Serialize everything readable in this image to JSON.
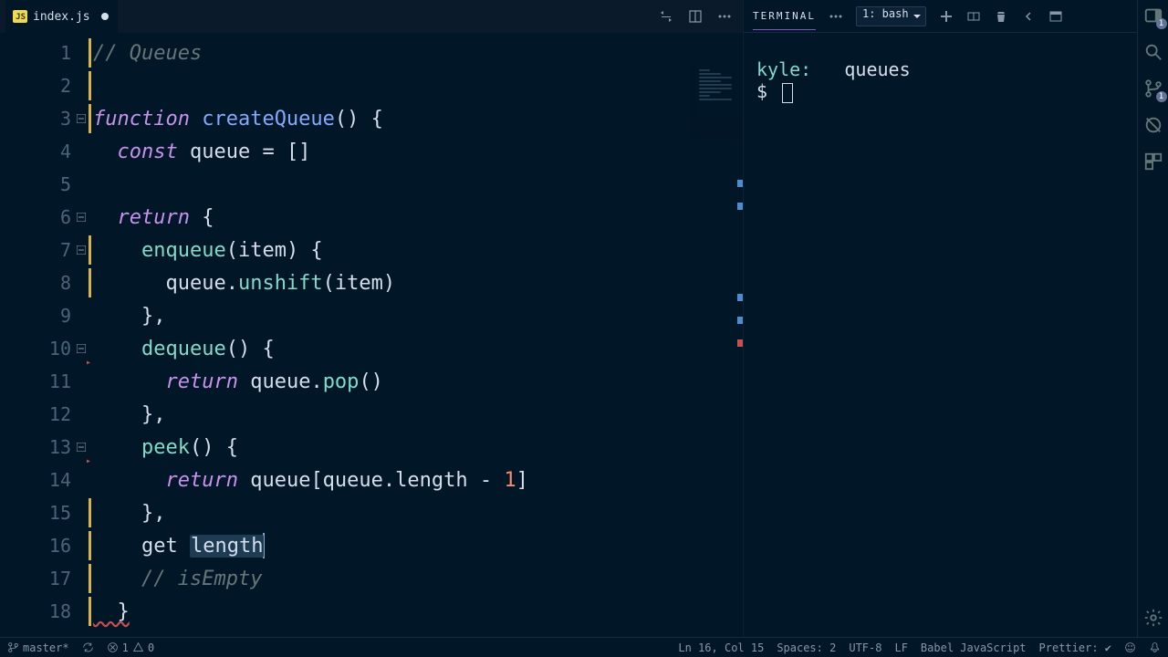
{
  "tab": {
    "filename": "index.js",
    "icon": "JS",
    "dirty": true
  },
  "editor_actions": {
    "compare": "compare-icon",
    "split": "split-icon",
    "more": "more-icon"
  },
  "code_lines": [
    {
      "n": 1,
      "mod": true,
      "tokens": [
        [
          "// Queues",
          "comment"
        ]
      ]
    },
    {
      "n": 2,
      "mod": true,
      "tokens": []
    },
    {
      "n": 3,
      "mod": true,
      "fold": true,
      "tokens": [
        [
          "function",
          "keyword"
        ],
        [
          " ",
          "punct"
        ],
        [
          "createQueue",
          "fn"
        ],
        [
          "() {",
          "punct"
        ]
      ]
    },
    {
      "n": 4,
      "mod": false,
      "tokens": [
        [
          "  ",
          "punct"
        ],
        [
          "const",
          "keyword"
        ],
        [
          " queue = []",
          "var"
        ]
      ]
    },
    {
      "n": 5,
      "mod": false,
      "tokens": []
    },
    {
      "n": 6,
      "mod": false,
      "fold": true,
      "tokens": [
        [
          "  ",
          "punct"
        ],
        [
          "return",
          "keyword"
        ],
        [
          " {",
          "punct"
        ]
      ]
    },
    {
      "n": 7,
      "mod": true,
      "fold": true,
      "tokens": [
        [
          "    ",
          "punct"
        ],
        [
          "enqueue",
          "prop"
        ],
        [
          "(",
          "punct"
        ],
        [
          "item",
          "ident"
        ],
        [
          ") {",
          "punct"
        ]
      ]
    },
    {
      "n": 8,
      "mod": true,
      "tokens": [
        [
          "      queue.",
          "var"
        ],
        [
          "unshift",
          "method"
        ],
        [
          "(",
          "punct"
        ],
        [
          "item",
          "ident"
        ],
        [
          ")",
          "punct"
        ]
      ]
    },
    {
      "n": 9,
      "mod": false,
      "tokens": [
        [
          "    },",
          "punct"
        ]
      ]
    },
    {
      "n": 10,
      "mod": false,
      "fold": true,
      "lint": true,
      "tokens": [
        [
          "    ",
          "punct"
        ],
        [
          "dequeue",
          "prop"
        ],
        [
          "() {",
          "punct"
        ]
      ]
    },
    {
      "n": 11,
      "mod": false,
      "tokens": [
        [
          "      ",
          "punct"
        ],
        [
          "return",
          "keyword"
        ],
        [
          " queue.",
          "var"
        ],
        [
          "pop",
          "method"
        ],
        [
          "()",
          "punct"
        ]
      ]
    },
    {
      "n": 12,
      "mod": false,
      "tokens": [
        [
          "    },",
          "punct"
        ]
      ]
    },
    {
      "n": 13,
      "mod": false,
      "fold": true,
      "lint": true,
      "tokens": [
        [
          "    ",
          "punct"
        ],
        [
          "peek",
          "prop"
        ],
        [
          "() {",
          "punct"
        ]
      ]
    },
    {
      "n": 14,
      "mod": false,
      "tokens": [
        [
          "      ",
          "punct"
        ],
        [
          "return",
          "keyword"
        ],
        [
          " queue[queue.length - ",
          "var"
        ],
        [
          "1",
          "num"
        ],
        [
          "]",
          "punct"
        ]
      ]
    },
    {
      "n": 15,
      "mod": true,
      "tokens": [
        [
          "    },",
          "punct"
        ]
      ]
    },
    {
      "n": 16,
      "mod": true,
      "current": true,
      "tokens": [
        [
          "    get ",
          "ident"
        ],
        [
          "length",
          "highlight"
        ]
      ]
    },
    {
      "n": 17,
      "mod": true,
      "tokens": [
        [
          "    ",
          "punct"
        ],
        [
          "// isEmpty",
          "comment"
        ]
      ]
    },
    {
      "n": 18,
      "mod": true,
      "err": true,
      "tokens": [
        [
          "  }",
          "punct"
        ]
      ]
    }
  ],
  "terminal": {
    "tab_label": "TERMINAL",
    "dropdown": "1: bash",
    "prompt_user": "kyle:",
    "prompt_dir": "queues",
    "prompt_char": "$"
  },
  "right_rail": {
    "toggle_badge": "1",
    "git_badge": "1"
  },
  "status": {
    "branch": "master*",
    "errors": "1",
    "warnings": "0",
    "cursor": "Ln 16, Col 15",
    "spaces": "Spaces: 2",
    "encoding": "UTF-8",
    "eol": "LF",
    "language": "Babel JavaScript",
    "prettier": "Prettier: ✔"
  }
}
